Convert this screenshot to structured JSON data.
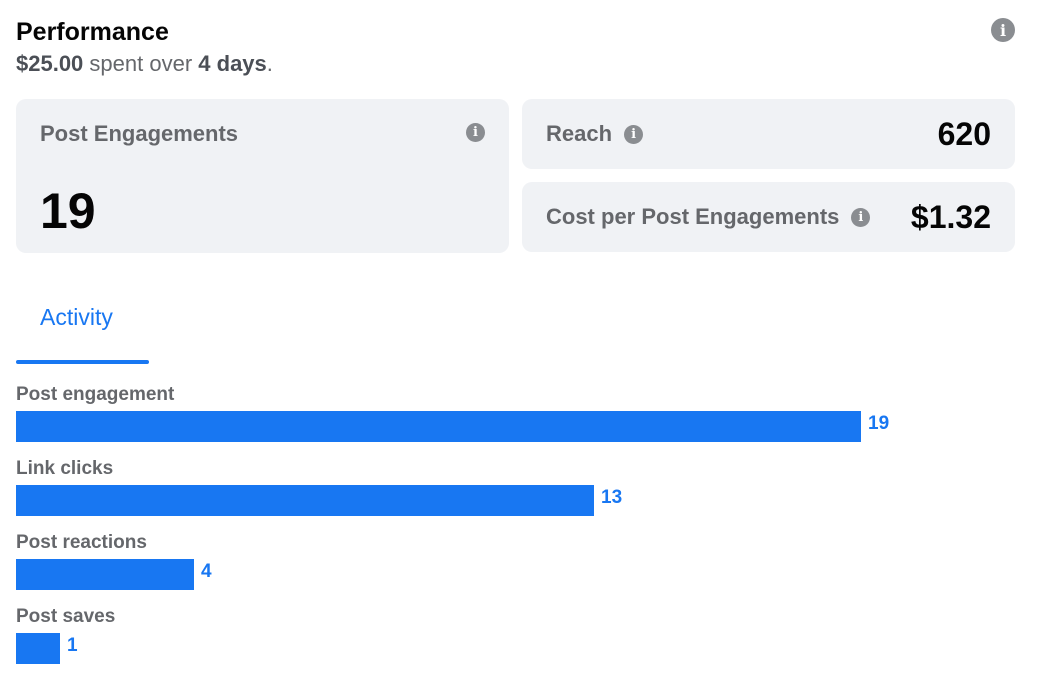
{
  "header": {
    "title": "Performance",
    "spent_amount": "$25.00",
    "spent_text": "spent over",
    "duration": "4 days",
    "period": "."
  },
  "icons": {
    "info": "i"
  },
  "cards": {
    "post_engagements": {
      "label": "Post Engagements",
      "value": "19"
    },
    "reach": {
      "label": "Reach",
      "value": "620"
    },
    "cost": {
      "label": "Cost per Post Engagements",
      "value": "$1.32"
    }
  },
  "tabs": [
    {
      "label": "Activity",
      "active": true
    }
  ],
  "colors": {
    "accent": "#1877f2",
    "card_bg": "#f0f2f5",
    "muted": "#65676b"
  },
  "chart_data": {
    "type": "bar",
    "orientation": "horizontal",
    "categories": [
      "Post engagement",
      "Link clicks",
      "Post reactions",
      "Post saves"
    ],
    "values": [
      19,
      13,
      4,
      1
    ],
    "xlim": [
      0,
      19
    ]
  }
}
